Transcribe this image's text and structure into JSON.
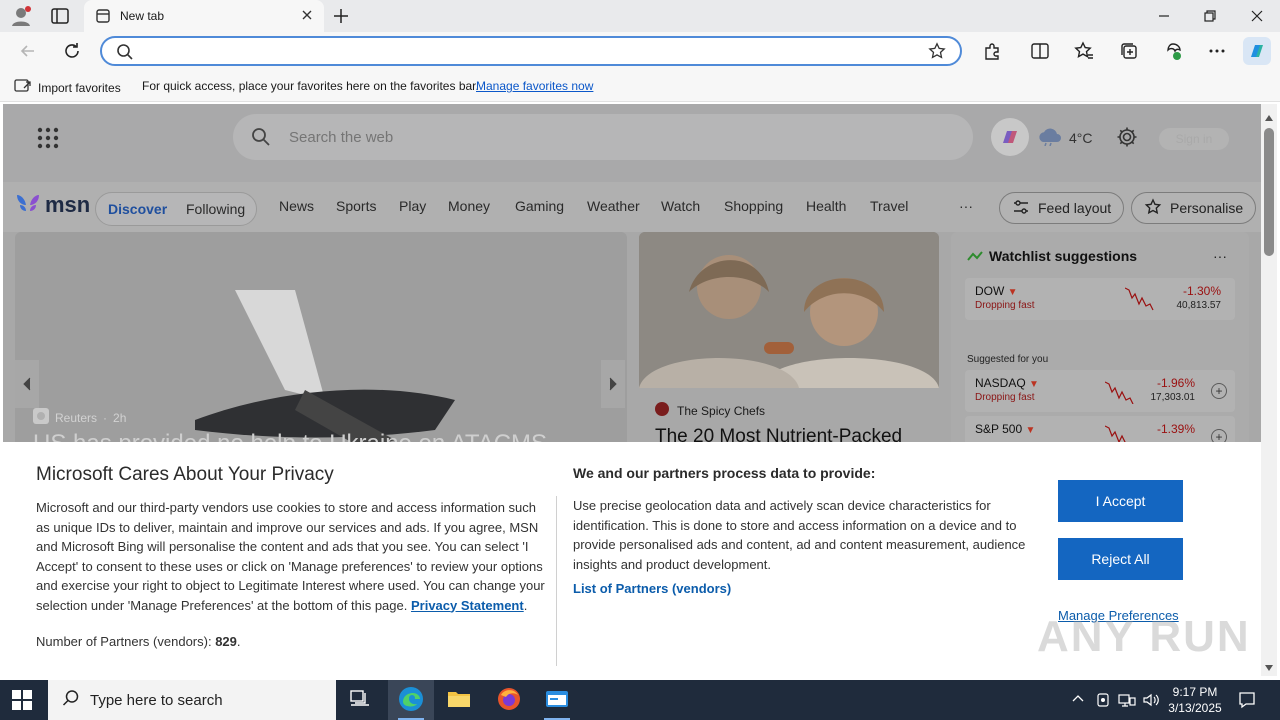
{
  "browser": {
    "tab": {
      "title": "New tab"
    },
    "address": {
      "value": "",
      "placeholder": ""
    },
    "favorites_bar": {
      "import_label": "Import favorites",
      "message": "For quick access, place your favorites here on the favorites bar.",
      "manage_link": "Manage favorites now"
    }
  },
  "msn": {
    "search_placeholder": "Search the web",
    "weather_temp": "4°C",
    "signin_label": "Sign in",
    "logo_text": "msn",
    "tabs": {
      "discover": "Discover",
      "following": "Following"
    },
    "nav": [
      "News",
      "Sports",
      "Play",
      "Money",
      "Gaming",
      "Weather",
      "Watch",
      "Shopping",
      "Health",
      "Travel"
    ],
    "nav_more": "···",
    "feed_layout": "Feed layout",
    "personalise": "Personalise",
    "hero": {
      "source": "Reuters",
      "age": "2h",
      "headline": "US has provided no help to Ukraine on ATACMS"
    },
    "card2": {
      "source": "The Spicy Chefs",
      "headline": "The 20 Most Nutrient-Packed"
    },
    "watchlist": {
      "title": "Watchlist suggestions",
      "more": "···",
      "suggested_label": "Suggested for you",
      "stocks": [
        {
          "symbol": "DOW",
          "state": "Dropping fast",
          "change": "-1.30%",
          "value": "40,813.57"
        },
        {
          "symbol": "NASDAQ",
          "state": "Dropping fast",
          "change": "-1.96%",
          "value": "17,303.01"
        },
        {
          "symbol": "S&P 500",
          "state": "",
          "change": "-1.39%",
          "value": ""
        }
      ]
    }
  },
  "privacy": {
    "title": "Microsoft Cares About Your Privacy",
    "body": "Microsoft and our third-party vendors use cookies to store and access information such as unique IDs to deliver, maintain and improve our services and ads. If you agree, MSN and Microsoft Bing will personalise the content and ads that you see. You can select 'I Accept' to consent to these uses or click on 'Manage preferences' to review your options and exercise your right to object to Legitimate Interest where used.  You can change your selection under 'Manage Preferences' at the bottom of this page.",
    "statement_link": "Privacy Statement",
    "partners_label": "Number of Partners (vendors):",
    "partners_count": "829",
    "title2": "We and our partners process data to provide:",
    "body2": "Use precise geolocation data and actively scan device characteristics for identification. This is done to store and access information on a device and to provide personalised ads and content, ad and content measurement, audience insights and product development.",
    "partners_link": "List of Partners (vendors)",
    "accept": "I Accept",
    "reject": "Reject All",
    "manage": "Manage Preferences",
    "watermark": "ANY RUN"
  },
  "taskbar": {
    "search_placeholder": "Type here to search",
    "time": "9:17 PM",
    "date": "3/13/2025"
  }
}
